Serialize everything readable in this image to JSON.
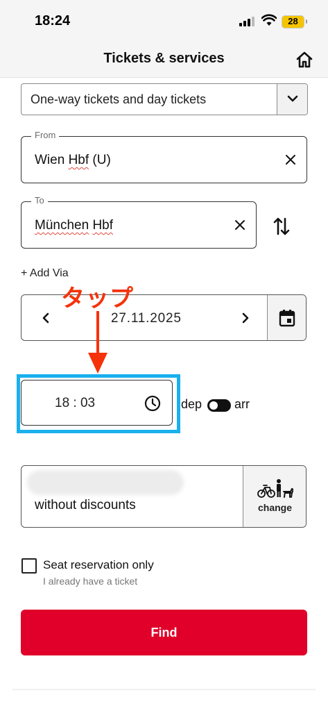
{
  "status_bar": {
    "time": "18:24",
    "battery": "28"
  },
  "header": {
    "title": "Tickets & services",
    "home_icon": "home-icon"
  },
  "ticket_type": {
    "selected": "One-way tickets and day tickets"
  },
  "from": {
    "legend": "From",
    "value_part1": "Wien ",
    "value_part2": "Hbf",
    "value_part3": " (U)"
  },
  "to": {
    "legend": "To",
    "value_part1": "München",
    "value_part2": " ",
    "value_part3": "Hbf"
  },
  "add_via": "+ Add Via",
  "date": {
    "value": "27.11.2025"
  },
  "annotation": {
    "text": "タップ",
    "color": "#f5320a"
  },
  "time": {
    "value": "18 : 03",
    "dep_label": "dep",
    "arr_label": "arr"
  },
  "passengers": {
    "text": "without discounts",
    "change_label": "change"
  },
  "seat": {
    "label": "Seat reservation only",
    "sublabel": "I already have a ticket"
  },
  "find": {
    "label": "Find"
  },
  "colors": {
    "brand_red": "#e0002a",
    "highlight_blue": "#1ab0ee"
  }
}
